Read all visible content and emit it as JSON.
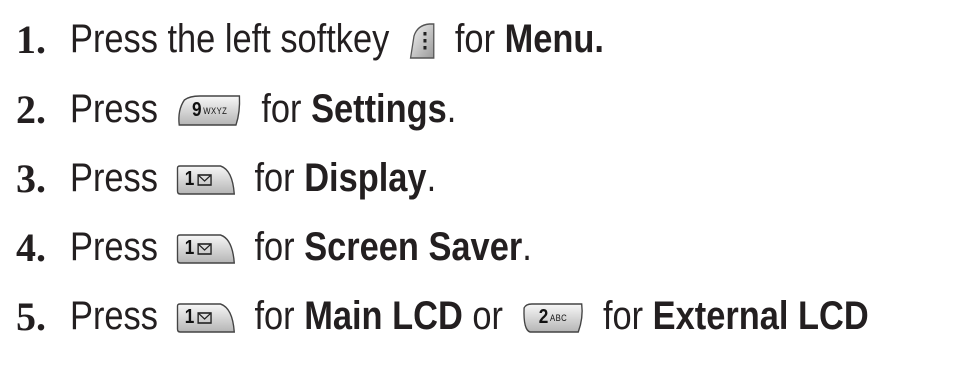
{
  "steps": [
    {
      "number": "1.",
      "before": "Press the left softkey",
      "after": "for",
      "bold": "Menu.",
      "trail": "",
      "key": {
        "icon": "left-softkey-icon",
        "digit": "",
        "letters": ""
      }
    },
    {
      "number": "2.",
      "before": "Press",
      "after": "for",
      "bold": "Settings",
      "trail": ".",
      "key": {
        "icon": "key-9-icon",
        "digit": "9",
        "letters": "WXYZ"
      }
    },
    {
      "number": "3.",
      "before": "Press",
      "after": "for",
      "bold": "Display",
      "trail": ".",
      "key": {
        "icon": "key-1-icon",
        "digit": "1",
        "letters": ""
      }
    },
    {
      "number": "4.",
      "before": "Press",
      "after": "for",
      "bold": "Screen Saver",
      "trail": ".",
      "key": {
        "icon": "key-1-icon",
        "digit": "1",
        "letters": ""
      }
    },
    {
      "number": "5.",
      "before": "Press",
      "after": "for",
      "bold": "Main LCD",
      "middle": "or",
      "after2": "for",
      "bold2": "External LCD",
      "key": {
        "icon": "key-1-icon",
        "digit": "1",
        "letters": ""
      },
      "key2": {
        "icon": "key-2-icon",
        "digit": "2",
        "letters": "ABC"
      }
    }
  ]
}
